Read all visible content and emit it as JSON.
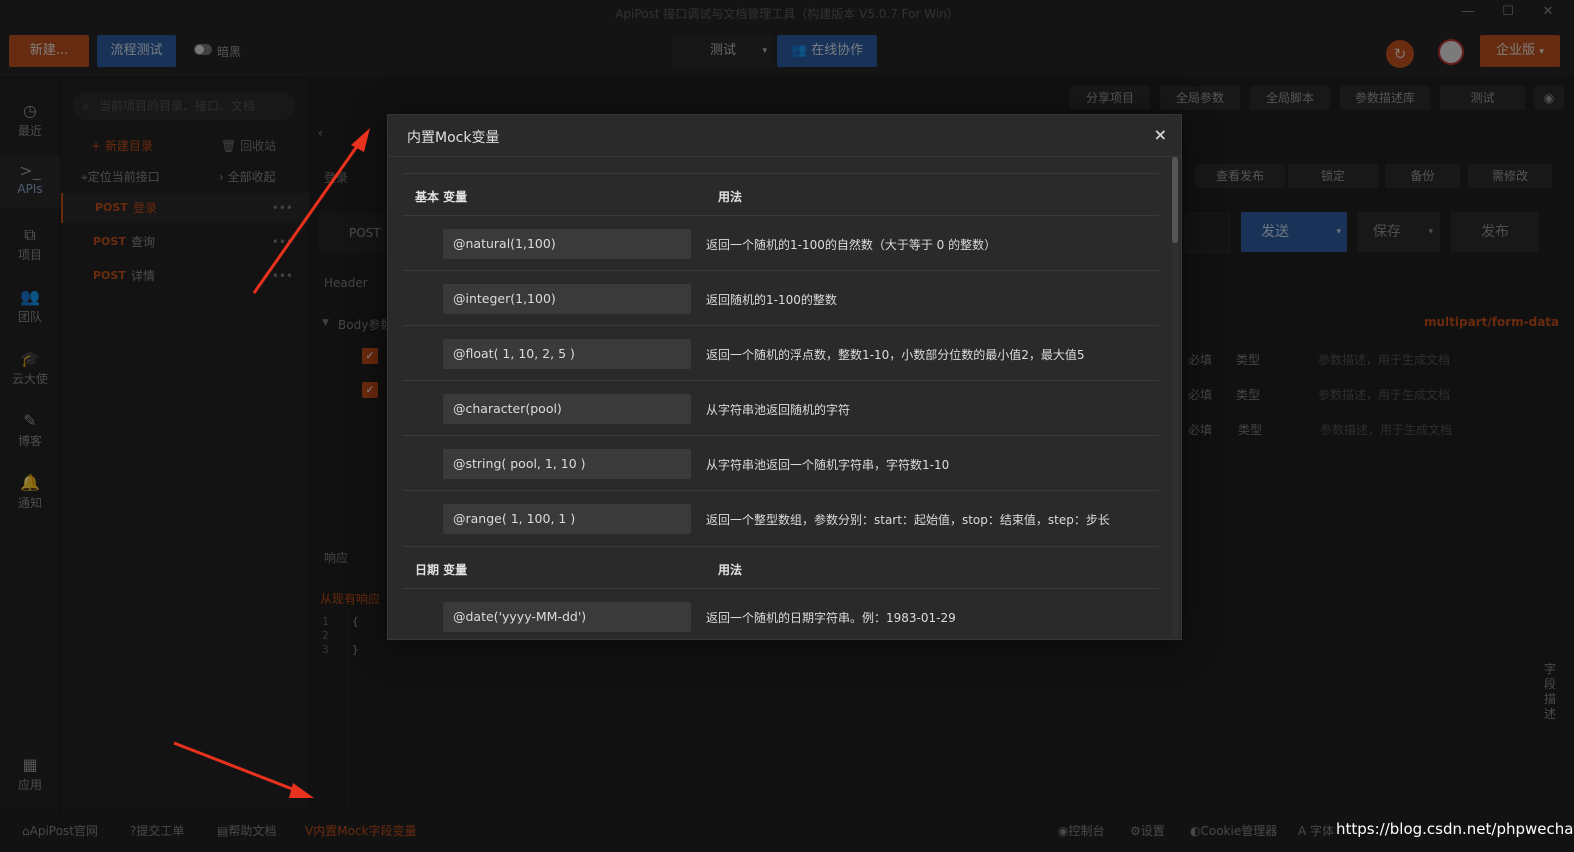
{
  "window": {
    "title": "ApiPost 接口调试与文档管理工具（构建版本 V5.0.7 For Win）",
    "minimize": "—",
    "maximize": "☐",
    "close": "✕"
  },
  "toolbar": {
    "new_label": "新建...",
    "flow_test_label": "流程测试",
    "dark_label": "暗黑",
    "env_label": "测试",
    "collab_label": "在线协作",
    "edition_label": "企业版"
  },
  "leftnav": {
    "items": [
      {
        "label": "最近",
        "icon": "clock-icon"
      },
      {
        "label": "APIs",
        "icon": "terminal-icon"
      },
      {
        "label": "项目",
        "icon": "project-icon"
      },
      {
        "label": "团队",
        "icon": "team-icon"
      },
      {
        "label": "云大使",
        "icon": "graduation-icon"
      },
      {
        "label": "博客",
        "icon": "edit-icon"
      },
      {
        "label": "通知",
        "icon": "bell-icon"
      },
      {
        "label": "应用",
        "icon": "apps-icon"
      }
    ]
  },
  "tree": {
    "search_placeholder": "当前项目的目录、接口、文档",
    "new_folder": "+ 新建目录",
    "recycle": "回收站",
    "locate": "定位当前接口",
    "collapse_all": "全部收起",
    "apis": [
      {
        "method": "POST",
        "name": "登录"
      },
      {
        "method": "POST",
        "name": "查询"
      },
      {
        "method": "POST",
        "name": "详情"
      }
    ]
  },
  "main": {
    "share": "分享项目",
    "global_params": "全局参数",
    "global_script": "全局脚本",
    "param_desc": "参数描述库",
    "env": "测试",
    "view_publish": "查看发布",
    "lock": "锁定",
    "backup": "备份",
    "need_modify": "需修改",
    "send": "发送",
    "save": "保存",
    "publish": "发布",
    "method": "POST",
    "tab_login": "登录",
    "header": "Header",
    "body_params": "Body参数",
    "content_type": "multipart/form-data",
    "required": "必填",
    "type": "类型",
    "desc_placeholder": "参数描述，用于生成文档",
    "response": "响应",
    "from_response": "从现有响应",
    "field_desc": "字段描述",
    "editor_lines": [
      "1",
      "2",
      "3"
    ],
    "editor_code": [
      "{",
      "",
      "}"
    ]
  },
  "statusbar": {
    "site": "ApiPost官网",
    "ticket": "提交工单",
    "help": "帮助文档",
    "mock": "内置Mock字段变量",
    "console": "控制台",
    "settings": "设置",
    "cookie": "Cookie管理器",
    "font": "字体"
  },
  "modal": {
    "title": "内置Mock变量",
    "close": "×",
    "sections": [
      {
        "name": "基本 变量",
        "usage_header": "用法",
        "rows": [
          {
            "code": "@natural(1,100)",
            "usage": "返回一个随机的1-100的自然数（大于等于 0 的整数）"
          },
          {
            "code": "@integer(1,100)",
            "usage": "返回随机的1-100的整数"
          },
          {
            "code": "@float( 1, 10, 2, 5 )",
            "usage": "返回一个随机的浮点数，整数1-10，小数部分位数的最小值2，最大值5"
          },
          {
            "code": "@character(pool)",
            "usage": "从字符串池返回随机的字符"
          },
          {
            "code": "@string( pool, 1, 10 )",
            "usage": "从字符串池返回一个随机字符串，字符数1-10"
          },
          {
            "code": "@range( 1, 100, 1 )",
            "usage": "返回一个整型数组，参数分别：start：起始值，stop：结束值，step：步长"
          }
        ]
      },
      {
        "name": "日期 变量",
        "usage_header": "用法",
        "rows": [
          {
            "code": "@date('yyyy-MM-dd')",
            "usage": "返回一个随机的日期字符串。例：1983-01-29"
          }
        ]
      }
    ]
  },
  "watermark": "https://blog.csdn.net/phpwechat",
  "colors": {
    "accent_orange": "#b8501f",
    "accent_blue": "#2f5c9e",
    "annotation_red": "#e8321e"
  }
}
